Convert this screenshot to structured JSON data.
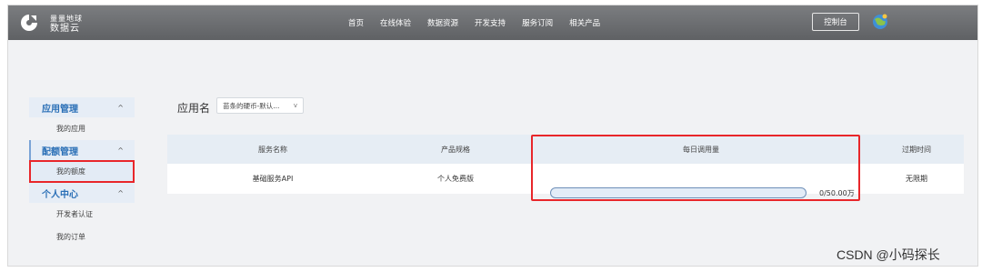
{
  "header": {
    "logo_line1": "量量地球",
    "logo_line2": "数据云",
    "nav": [
      "首页",
      "在线体验",
      "数据资源",
      "开发支持",
      "服务订阅",
      "相关产品"
    ],
    "console_label": "控制台",
    "avatar_icon": "globe-avatar-icon"
  },
  "sidebar": {
    "groups": [
      {
        "title": "应用管理",
        "items": [
          "我的应用"
        ]
      },
      {
        "title": "配额管理",
        "items": [
          "我的额度"
        ]
      },
      {
        "title": "个人中心",
        "items": [
          "开发者认证",
          "我的订单"
        ]
      }
    ],
    "chevron_icon": "chevron-up-icon"
  },
  "content": {
    "app_label": "应用名",
    "app_select_value": "苗条的硬币-默认...",
    "table": {
      "headers": [
        "服务名称",
        "产品规格",
        "每日调用量",
        "过期时间"
      ],
      "rows": [
        {
          "service": "基础服务API",
          "spec": "个人免费版",
          "usage_fraction": 0,
          "usage_text": "0/50.00万",
          "expiry": "无限期"
        }
      ]
    }
  },
  "watermark": "CSDN @小码探长",
  "colors": {
    "highlight": "#e8262a",
    "accent": "#2a6fb6",
    "header_bg": "#6c6e71"
  }
}
